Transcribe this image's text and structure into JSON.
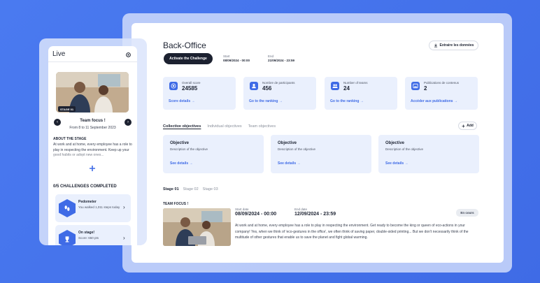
{
  "backoffice": {
    "title": "Back-Office",
    "activate_button": "Activate the Challenge",
    "start_label": "Start",
    "start_value": "08/09/2024 - 00:00",
    "end_label": "End",
    "end_value": "21/09/2024 - 23:59",
    "export_button": "Extraire les données",
    "stats": [
      {
        "label": "Overall score",
        "value": "24585",
        "link": "Score details →",
        "icon": "target-icon"
      },
      {
        "label": "Nombre de participants",
        "value": "456",
        "link": "Go to the ranking →",
        "icon": "user-icon"
      },
      {
        "label": "Number of teams",
        "value": "24",
        "link": "Go to the ranking →",
        "icon": "team-icon"
      },
      {
        "label": "Publications de contenus",
        "value": "2",
        "link": "Accéder aux publications →",
        "icon": "image-icon"
      }
    ],
    "objective_tabs": [
      "Collective objectives",
      "Individual objectives",
      "Team objectives"
    ],
    "add_button": "Add",
    "objectives": [
      {
        "title": "Objective",
        "desc": "Description of the objective",
        "link": "See details →"
      },
      {
        "title": "Objective",
        "desc": "Description of the objective",
        "link": "See details →"
      },
      {
        "title": "Objective",
        "desc": "Description of the objective",
        "link": "See details →"
      }
    ],
    "stage_tabs": [
      "Stage 01",
      "Stage 02",
      "Stage 03"
    ],
    "team_focus_label": "TEAM FOCUS !",
    "stage_start_label": "Start date",
    "stage_start_value": "08/09/2024 - 00:00",
    "stage_end_label": "End date",
    "stage_end_value": "12/09/2024 - 23:59",
    "status_badge": "En cours",
    "stage_description": "At work and at home, every employee has a role to play in respecting the environment. Get ready to become the king or queen of eco-actions in your company! Yes, when we think of 'eco-gestures in the office', we often think of saving paper, double-sided printing... But we don't necessarily think of the multitude of other gestures that enable us to save the planet and fight global warming."
  },
  "mobile": {
    "title": "Live",
    "stage_badge": "STAGE 01",
    "stage_title": "Team focus !",
    "stage_dates": "From 8 to 11 September 2023",
    "about_label": "ABOUT THE STAGE",
    "about_text": "At work and at home, every employee has a role to play in respecting the environment. Keep up your good habits or adopt new ones...",
    "challenges_label": "0/5 CHALLENGES COMPLETED",
    "challenges": [
      {
        "title": "Pedometer",
        "subtitle": "You walked 1,011 steps today",
        "icon": "footprints-icon"
      },
      {
        "title": "On stage!",
        "subtitle": "Score: 650 pts",
        "icon": "trophy-icon"
      }
    ]
  },
  "colors": {
    "accent": "#3f6be6",
    "dark": "#1c2130",
    "card_bg": "#eaf0fd"
  }
}
